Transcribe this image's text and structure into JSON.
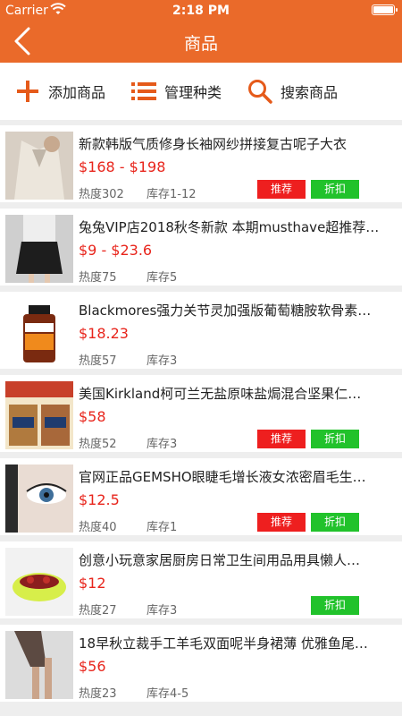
{
  "status_bar": {
    "carrier": "Carrier",
    "time": "2:18 PM"
  },
  "nav": {
    "title": "商品"
  },
  "toolbar": {
    "add_label": "添加商品",
    "manage_label": "管理种类",
    "search_label": "搜索商品"
  },
  "colors": {
    "accent": "#ea6a2a",
    "price": "#e8251c",
    "recommend": "#ee1f1f",
    "discount": "#21c22b"
  },
  "buttons": {
    "recommend": "推荐",
    "discount": "折扣"
  },
  "products": [
    {
      "title": "新款韩版气质修身长袖网纱拼接复古呢子大衣",
      "price": "$168 - $198",
      "heat": "热度302",
      "stock": "库存1-12",
      "recommend": true,
      "discount": true,
      "thumb": "coat"
    },
    {
      "title": "兔兔VIP店2018秋冬新款 本期musthave超推荐…",
      "price": "$9 - $23.6",
      "heat": "热度75",
      "stock": "库存5",
      "recommend": false,
      "discount": false,
      "thumb": "skirt"
    },
    {
      "title": "Blackmores强力关节灵加强版葡萄糖胺软骨素…",
      "price": "$18.23",
      "heat": "热度57",
      "stock": "库存3",
      "recommend": false,
      "discount": false,
      "thumb": "bottle"
    },
    {
      "title": "美国Kirkland柯可兰无盐原味盐焗混合坚果仁…",
      "price": "$58",
      "heat": "热度52",
      "stock": "库存3",
      "recommend": true,
      "discount": true,
      "thumb": "nuts"
    },
    {
      "title": "官网正品GEMSHO眼睫毛增长液女浓密眉毛生…",
      "price": "$12.5",
      "heat": "热度40",
      "stock": "库存1",
      "recommend": true,
      "discount": true,
      "thumb": "eye"
    },
    {
      "title": "创意小玩意家居厨房日常卫生间用品用具懒人…",
      "price": "$12",
      "heat": "热度27",
      "stock": "库存3",
      "recommend": false,
      "discount": true,
      "thumb": "basket"
    },
    {
      "title": "18早秋立裁手工羊毛双面呢半身裙薄 优雅鱼尾…",
      "price": "$56",
      "heat": "热度23",
      "stock": "库存4-5",
      "recommend": false,
      "discount": false,
      "thumb": "legs"
    }
  ]
}
